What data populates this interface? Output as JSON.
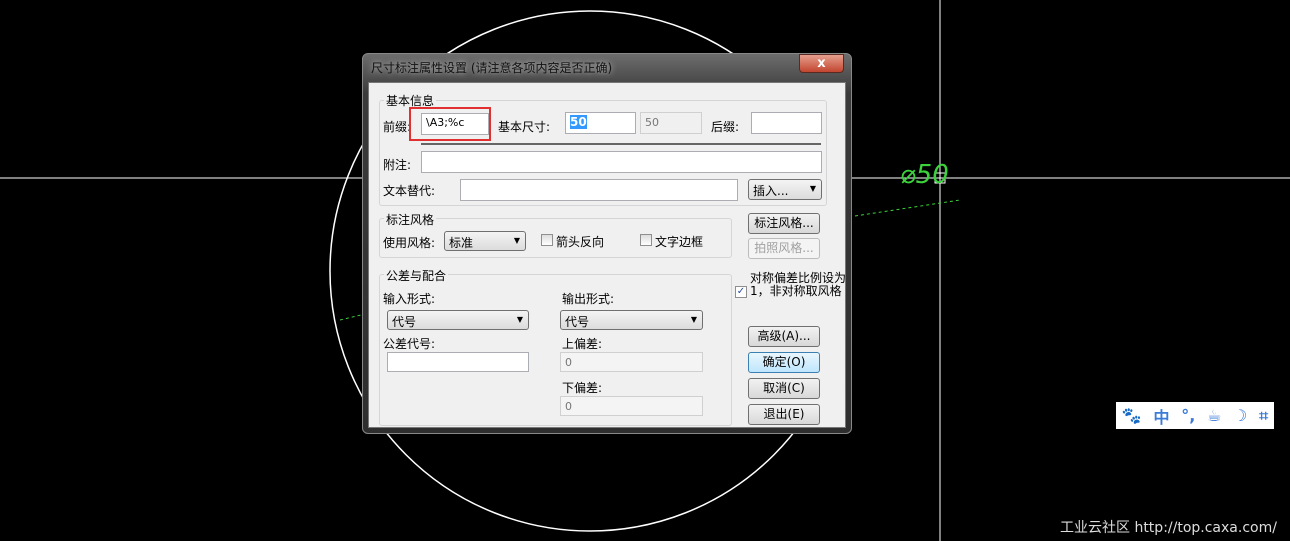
{
  "canvas": {
    "dimension_text": "⌀50",
    "watermark": "工业云社区 http://top.caxa.com/",
    "line_color": "#ffffff",
    "dim_color": "#3cd23c"
  },
  "dialog": {
    "title": "尺寸标注属性设置 (请注意各项内容是否正确)",
    "close": "x",
    "basic": {
      "group": "基本信息",
      "prefix_label": "前缀:",
      "prefix_value": "\\A3;%c",
      "base_label": "基本尺寸:",
      "base_value": "50",
      "base_readonly": "50",
      "suffix_label": "后缀:",
      "suffix_value": "",
      "note_label": "附注:",
      "note_value": "",
      "replace_label": "文本替代:",
      "replace_value": "",
      "insert_label": "插入..."
    },
    "style": {
      "group": "标注风格",
      "use_label": "使用风格:",
      "use_value": "标准",
      "arrow_reverse": "箭头反向",
      "text_border": "文字边框"
    },
    "tol": {
      "group": "公差与配合",
      "input_label": "输入形式:",
      "input_value": "代号",
      "code_label": "公差代号:",
      "code_value": "",
      "output_label": "输出形式:",
      "output_value": "代号",
      "upper_label": "上偏差:",
      "upper_value": "0",
      "lower_label": "下偏差:",
      "lower_value": "0"
    },
    "sym_checkbox": "对称偏差比例设为1，非对称取风格",
    "buttons": {
      "style": "标注风格...",
      "photo": "拍照风格...",
      "advanced": "高级(A)...",
      "ok": "确定(O)",
      "cancel": "取消(C)",
      "exit": "退出(E)"
    }
  },
  "ime": {
    "items": [
      "🐾",
      "中",
      "°,",
      "☕",
      "☽",
      "⌗"
    ]
  }
}
